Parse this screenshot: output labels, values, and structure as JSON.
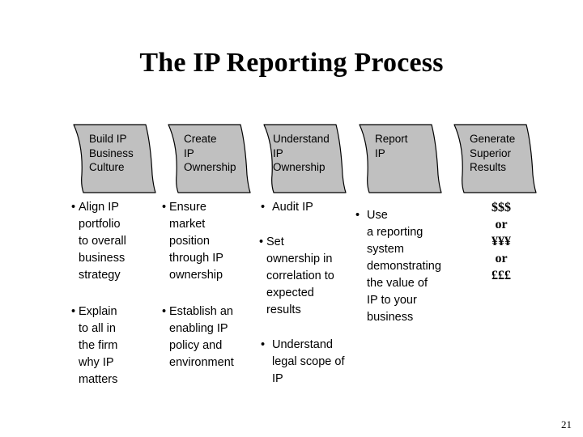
{
  "slide": {
    "title": "The IP Reporting Process",
    "page_number": "21",
    "colors": {
      "chevron_fill": "#C0C0C0",
      "chevron_stroke": "#000000",
      "text": "#000000",
      "background": "#FFFFFF"
    }
  },
  "process": {
    "steps": [
      {
        "id": "build-ip-business-culture",
        "label": "Build IP\nBusiness\nCulture"
      },
      {
        "id": "create-ip-ownership",
        "label": "Create\nIP\nOwnership"
      },
      {
        "id": "understand-ip-ownership",
        "label": "Understand\nIP\nOwnership"
      },
      {
        "id": "report-ip",
        "label": "Report\nIP"
      },
      {
        "id": "generate-superior-results",
        "label": "Generate\nSuperior\nResults"
      }
    ]
  },
  "columns": [
    {
      "id": "column-build-ip-business-culture",
      "bullets": [
        {
          "marker": "•",
          "text": "Align IP\nportfolio\nto overall\nbusiness\nstrategy"
        },
        {
          "marker": "•",
          "text": "Explain\nto all in\nthe firm\nwhy IP\nmatters"
        }
      ]
    },
    {
      "id": "column-create-ip-ownership",
      "bullets": [
        {
          "marker": "•",
          "text": "Ensure\nmarket\nposition\nthrough IP\nownership"
        },
        {
          "marker": "•",
          "text": "Establish an\nenabling IP\npolicy and\nenvironment"
        }
      ]
    },
    {
      "id": "column-understand-ip-ownership",
      "bullets": [
        {
          "marker": "•",
          "text": "Audit IP"
        },
        {
          "marker": "•",
          "text": "Set\nownership in\ncorrelation to\nexpected\nresults"
        },
        {
          "marker": "•",
          "text": "Understand\nlegal scope of\nIP"
        }
      ]
    },
    {
      "id": "column-report-ip",
      "bullets": [
        {
          "marker": "•",
          "text": "Use\na reporting\nsystem\ndemonstrating\nthe value of\nIP to your\nbusiness"
        }
      ]
    }
  ],
  "outcome": {
    "id": "column-generate-superior-results",
    "lines": [
      "$$$",
      "or",
      "¥¥¥",
      "or",
      "£££"
    ]
  }
}
